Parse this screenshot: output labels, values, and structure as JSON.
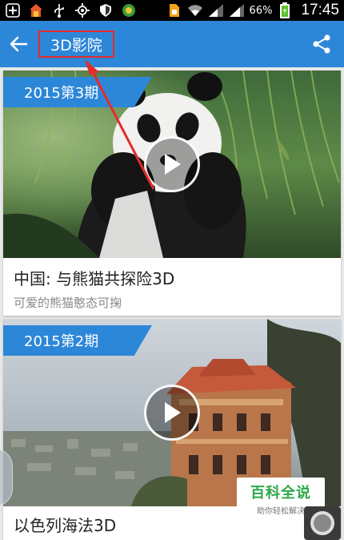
{
  "status_bar": {
    "battery_percent": "66%",
    "time": "17:45",
    "icons": [
      "add-icon",
      "app-icon",
      "usb-icon",
      "gps-icon",
      "shield-icon",
      "app-icon-2",
      "sim-icon",
      "wifi-icon",
      "signal-icon",
      "signal-icon-2",
      "battery-icon"
    ]
  },
  "app_bar": {
    "title": "3D影院",
    "back_icon": "arrow-left-icon",
    "share_icon": "share-icon",
    "color": "#2d87d8",
    "highlight_color": "#e52b2b"
  },
  "cards": [
    {
      "badge": "2015第3期",
      "title": "中国: 与熊猫共探险3D",
      "subtitle": "可爱的熊猫憨态可掬"
    },
    {
      "badge": "2015第2期",
      "title": "以色列海法3D",
      "subtitle": ""
    }
  ],
  "watermark": {
    "main": "百科全说",
    "sub": "助你轻松解决"
  }
}
